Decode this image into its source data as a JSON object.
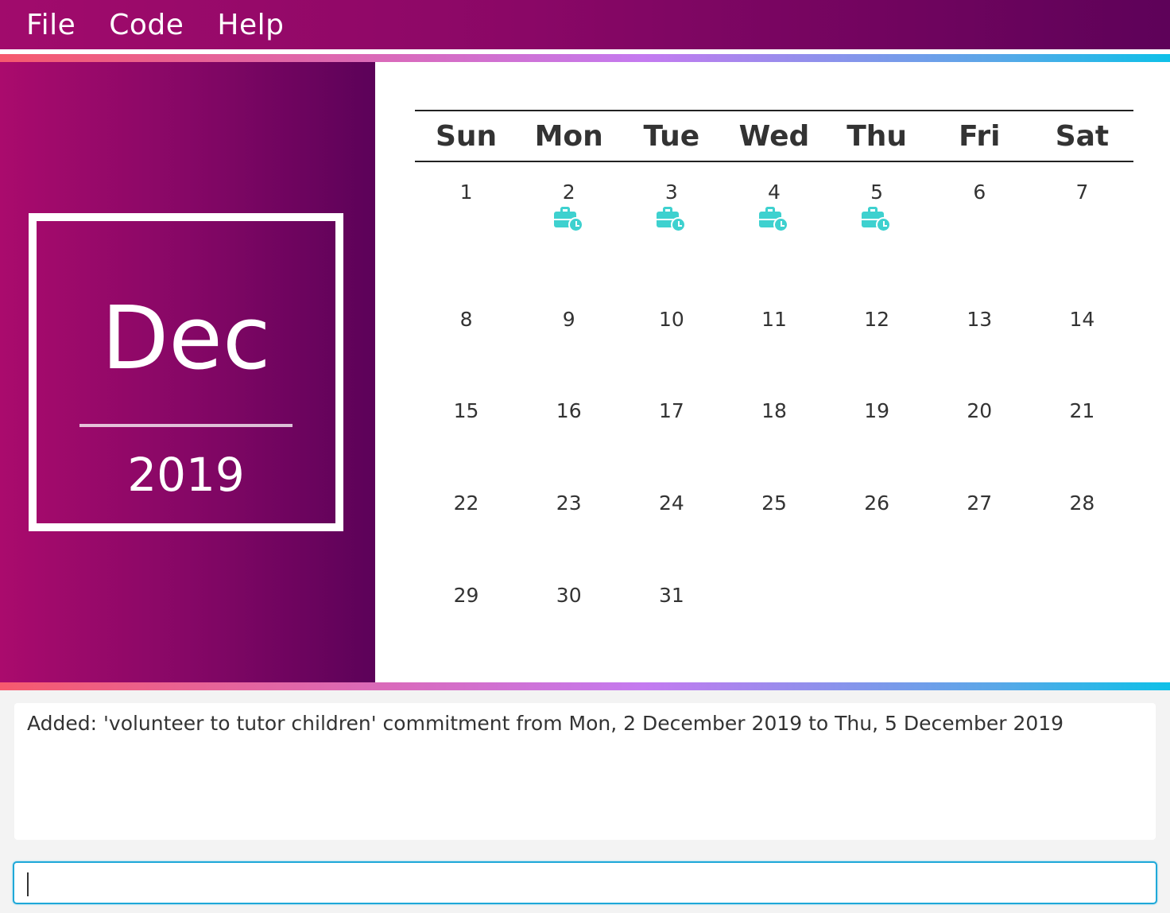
{
  "menu": {
    "items": [
      {
        "label": "File"
      },
      {
        "label": "Code"
      },
      {
        "label": "Help"
      }
    ]
  },
  "sidebar": {
    "month": "Dec",
    "year": "2019"
  },
  "calendar": {
    "day_names": [
      "Sun",
      "Mon",
      "Tue",
      "Wed",
      "Thu",
      "Fri",
      "Sat"
    ],
    "weeks": [
      [
        "1",
        "2",
        "3",
        "4",
        "5",
        "6",
        "7"
      ],
      [
        "8",
        "9",
        "10",
        "11",
        "12",
        "13",
        "14"
      ],
      [
        "15",
        "16",
        "17",
        "18",
        "19",
        "20",
        "21"
      ],
      [
        "22",
        "23",
        "24",
        "25",
        "26",
        "27",
        "28"
      ],
      [
        "29",
        "30",
        "31",
        "",
        "",
        "",
        ""
      ]
    ],
    "event_days": [
      "2",
      "3",
      "4",
      "5"
    ],
    "event_icon": "briefcase-clock-icon",
    "event_color": "#3ed1cf"
  },
  "result": {
    "text": "Added: 'volunteer to tutor children' commitment from Mon, 2 December 2019 to Thu, 5 December 2019"
  },
  "command": {
    "value": ""
  }
}
